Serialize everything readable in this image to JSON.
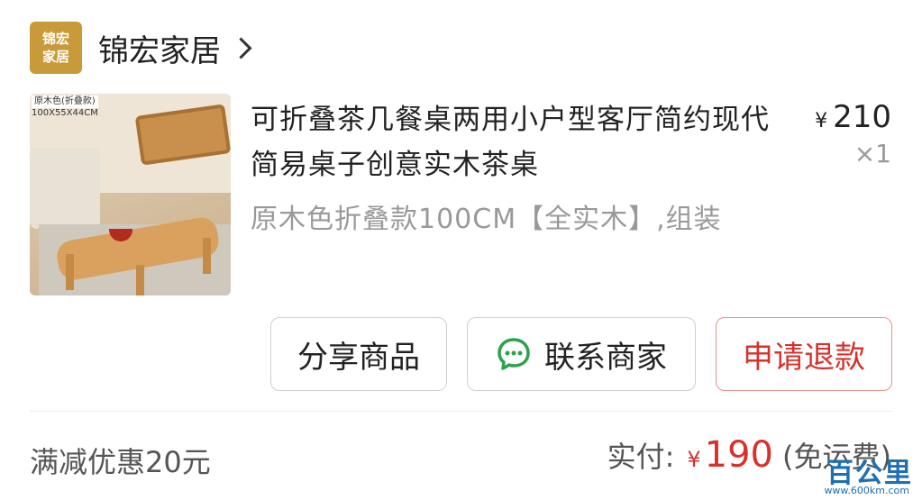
{
  "store": {
    "logo_text": "锦宏\n家居",
    "name": "锦宏家居"
  },
  "product": {
    "image_spec_tag": "原木色(折叠款)",
    "image_size_label": "100X55X44CM",
    "title": "可折叠茶几餐桌两用小户型客厅简约现代简易桌子创意实木茶桌",
    "price_symbol": "¥",
    "price": "210",
    "quantity": "×1",
    "spec": "原木色折叠款100CM【全实木】,组装"
  },
  "actions": {
    "share_label": "分享商品",
    "contact_label": "联系商家",
    "refund_label": "申请退款"
  },
  "summary": {
    "discount_text": "满减优惠20元",
    "paid_label": "实付:",
    "paid_symbol": "¥",
    "paid_amount": "190",
    "shipping_note": "(免运费)"
  },
  "watermark": {
    "text": "百公里",
    "url": "www.600km.com"
  },
  "colors": {
    "accent_red": "#d8312a",
    "logo_gold": "#c99a3a",
    "chat_green": "#2aa34a"
  }
}
